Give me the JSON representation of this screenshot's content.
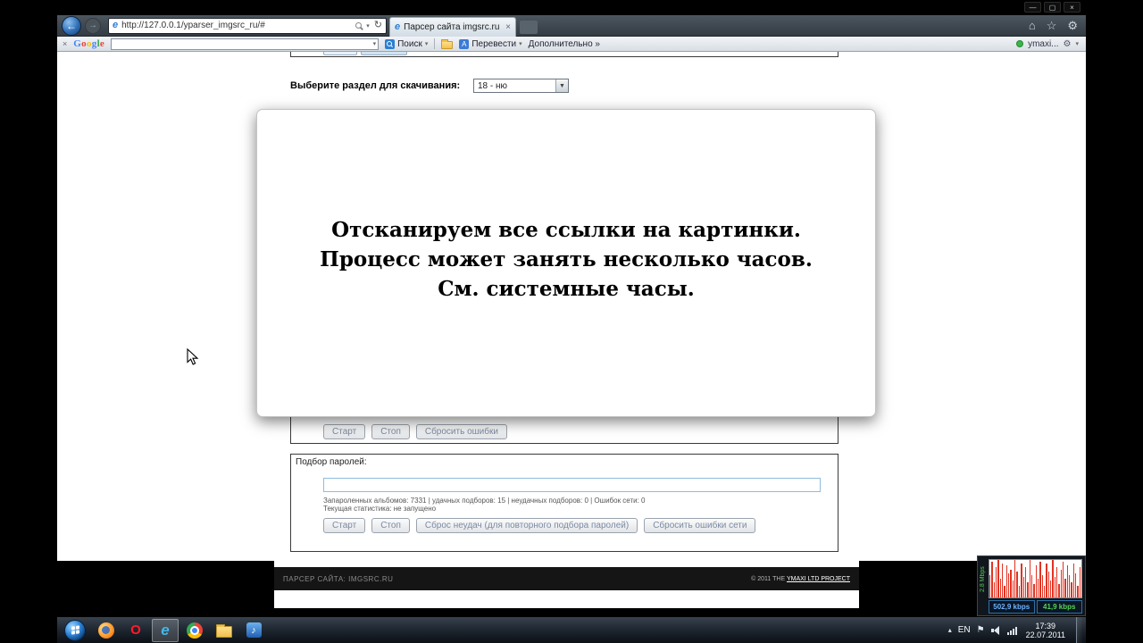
{
  "window": {
    "url": "http://127.0.0.1/yparser_imgsrc_ru/#",
    "tab_title": "Парсер сайта imgsrc.ru"
  },
  "gtoolbar": {
    "logo": "Google",
    "input_value": "",
    "search_button": "Поиск",
    "translate": "Перевести",
    "more": "Дополнительно »",
    "account": "ymaxi..."
  },
  "page": {
    "section_label": "Выберите раздел для скачивания:",
    "section_select_value": "18 - ню",
    "overlay": {
      "line1": "Отсканируем все ссылки на картинки.",
      "line2": "Процесс может занять несколько часов.",
      "line3": "См. системные часы."
    },
    "scan": {
      "start": "Старт",
      "stop": "Стоп",
      "reset_errors": "Сбросить  ошибки"
    },
    "passwords": {
      "title": "Подбор паролей:",
      "input_value": "",
      "stats_line1": "Запароленных альбомов: 7331 | удачных подборов: 15 | неудачных подборов: 0 | Ошибок сети: 0",
      "stats_line2": "Текущая статистика: не запущено",
      "start": "Старт",
      "stop": "Стоп",
      "reset_fails": "Сброс неудач (для повторного подбора паролей)",
      "reset_net_errors": "Сбросить ошибки сети"
    },
    "footer": {
      "left": "ПАРСЕР САЙТА: IMGSRC.RU",
      "right_prefix": "© 2011 THE ",
      "right_link": "YMAXI LTD PROJECT"
    }
  },
  "gadget": {
    "scale": "2.8 Mbps",
    "download": "502,9 kbps",
    "upload": "41,9 kbps",
    "bars": [
      0.6,
      0.95,
      0.4,
      0.8,
      1,
      0.5,
      0.9,
      0.3,
      0.85,
      0.65,
      0.75,
      0.45,
      1,
      0.7,
      0.3,
      0.9,
      0.55,
      0.8,
      0.4,
      1,
      0.6,
      0.35,
      0.85,
      0.5,
      0.95,
      0.6,
      0.3,
      0.9,
      0.7,
      0.45,
      1,
      0.55,
      0.8,
      0.35,
      0.75,
      0.95,
      0.5,
      0.85,
      0.6,
      0.4,
      0.9,
      0.65,
      0.3,
      0.8
    ]
  },
  "taskbar": {
    "lang": "EN",
    "time": "17:39",
    "date": "22.07.2011"
  },
  "colors": {
    "accent_blue": "#2a7fd4",
    "bar_red": "#e23322",
    "download_text": "#6db3ff",
    "upload_text": "#55d455"
  },
  "google_letter_colors": [
    "#4285f4",
    "#ea4335",
    "#fbbc05",
    "#4285f4",
    "#34a853",
    "#ea4335"
  ]
}
